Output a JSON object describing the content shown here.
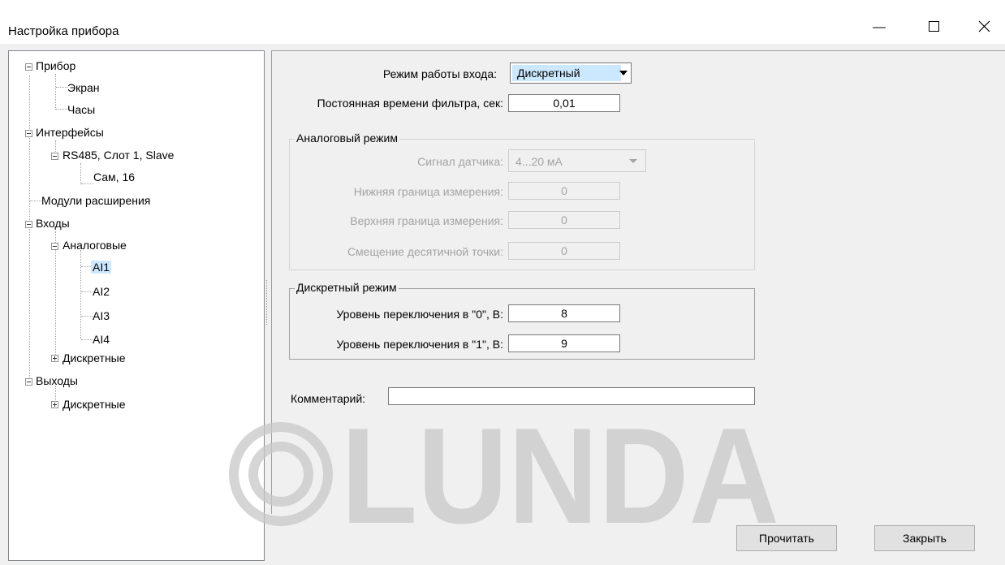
{
  "window": {
    "title": "Настройка прибора"
  },
  "tree": {
    "nodes": [
      {
        "label": "Прибор"
      },
      {
        "label": "Экран"
      },
      {
        "label": "Часы"
      },
      {
        "label": "Интерфейсы"
      },
      {
        "label": "RS485, Слот 1, Slave"
      },
      {
        "label": "Сам, 16"
      },
      {
        "label": "Модули расширения"
      },
      {
        "label": "Входы"
      },
      {
        "label": "Аналоговые"
      },
      {
        "label": "AI1"
      },
      {
        "label": "AI2"
      },
      {
        "label": "AI3"
      },
      {
        "label": "AI4"
      },
      {
        "label": "Дискретные"
      },
      {
        "label": "Выходы"
      },
      {
        "label": "Дискретные"
      }
    ],
    "selected": "AI1"
  },
  "settings": {
    "input_mode_label": "Режим работы входа:",
    "input_mode_value": "Дискретный",
    "filter_label": "Постоянная времени фильтра, сек:",
    "filter_value": "0,01",
    "analog_group": {
      "title": "Аналоговый режим",
      "sensor_label": "Сигнал датчика:",
      "sensor_value": "4...20 мА",
      "lower_label": "Нижняя граница измерения:",
      "lower_value": "0",
      "upper_label": "Верхняя граница измерения:",
      "upper_value": "0",
      "decimal_label": "Смещение десятичной точки:",
      "decimal_value": "0"
    },
    "discrete_group": {
      "title": "Дискретный режим",
      "level0_label": "Уровень переключения в \"0\", В:",
      "level0_value": "8",
      "level1_label": "Уровень переключения в \"1\", В:",
      "level1_value": "9"
    },
    "comment_label": "Комментарий:",
    "comment_value": ""
  },
  "buttons": {
    "read": "Прочитать",
    "close": "Закрыть"
  },
  "watermark": {
    "text": "LUNDA"
  },
  "colors": {
    "selection": "#cce8ff",
    "background": "#f0f0f0",
    "disabled_text": "#a3a3a3"
  }
}
